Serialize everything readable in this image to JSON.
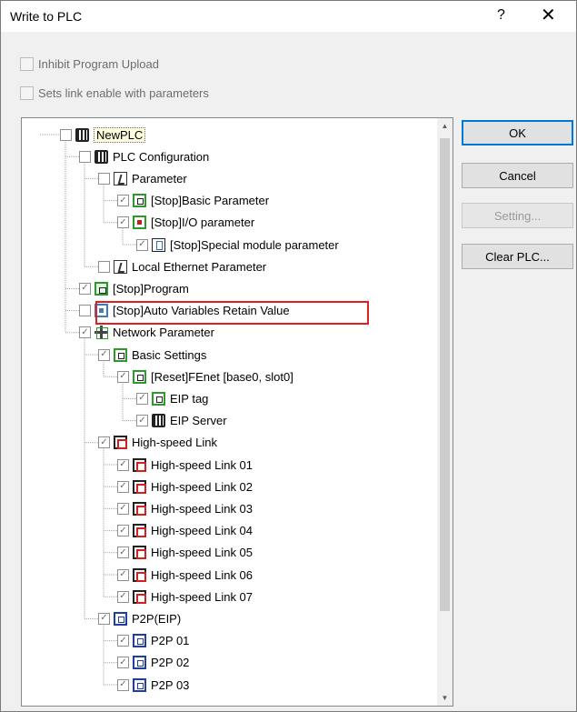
{
  "dialog": {
    "title": "Write to PLC",
    "help_label": "?",
    "close_label": "✕"
  },
  "options": {
    "inhibit_program_upload": {
      "label": "Inhibit Program Upload",
      "checked": false
    },
    "sets_link_enable": {
      "label": "Sets link enable with parameters",
      "checked": false
    }
  },
  "tree": {
    "items": [
      {
        "label": "NewPLC",
        "icon": "plc-icon",
        "checked": false
      },
      {
        "label": "PLC Configuration",
        "icon": "plc-icon",
        "checked": false
      },
      {
        "label": "Parameter",
        "icon": "parameter-icon",
        "checked": false
      },
      {
        "label": "[Stop]Basic Parameter",
        "icon": "basic-parameter-icon",
        "checked": true
      },
      {
        "label": "[Stop]I/O parameter",
        "icon": "io-parameter-icon",
        "checked": true
      },
      {
        "label": "[Stop]Special module parameter",
        "icon": "special-module-icon",
        "checked": true
      },
      {
        "label": "Local Ethernet Parameter",
        "icon": "parameter-icon",
        "checked": false
      },
      {
        "label": "[Stop]Program",
        "icon": "program-icon",
        "checked": true
      },
      {
        "label": "[Stop]Auto Variables Retain Value",
        "icon": "auto-variables-icon",
        "checked": false
      },
      {
        "label": "Network Parameter",
        "icon": "network-icon",
        "checked": true
      },
      {
        "label": "Basic Settings",
        "icon": "basic-parameter-icon",
        "checked": true
      },
      {
        "label": "[Reset]FEnet [base0, slot0]",
        "icon": "basic-parameter-icon",
        "checked": true
      },
      {
        "label": "EIP tag",
        "icon": "basic-parameter-icon",
        "checked": true
      },
      {
        "label": "EIP Server",
        "icon": "plc-icon",
        "checked": true
      },
      {
        "label": "High-speed Link",
        "icon": "high-speed-link-icon",
        "checked": true
      },
      {
        "label": "High-speed Link 01",
        "icon": "high-speed-link-icon",
        "checked": true
      },
      {
        "label": "High-speed Link 02",
        "icon": "high-speed-link-icon",
        "checked": true
      },
      {
        "label": "High-speed Link 03",
        "icon": "high-speed-link-icon",
        "checked": true
      },
      {
        "label": "High-speed Link 04",
        "icon": "high-speed-link-icon",
        "checked": true
      },
      {
        "label": "High-speed Link 05",
        "icon": "high-speed-link-icon",
        "checked": true
      },
      {
        "label": "High-speed Link 06",
        "icon": "high-speed-link-icon",
        "checked": true
      },
      {
        "label": "High-speed Link 07",
        "icon": "high-speed-link-icon",
        "checked": true
      },
      {
        "label": "P2P(EIP)",
        "icon": "p2p-icon",
        "checked": true
      },
      {
        "label": "P2P 01",
        "icon": "p2p-icon",
        "checked": true
      },
      {
        "label": "P2P 02",
        "icon": "p2p-icon",
        "checked": true
      },
      {
        "label": "P2P 03",
        "icon": "p2p-icon",
        "checked": true
      }
    ]
  },
  "buttons": {
    "ok": "OK",
    "cancel": "Cancel",
    "setting": "Setting...",
    "clear_plc": "Clear PLC..."
  },
  "colors": {
    "highlight_border": "#e02020",
    "ok_focus": "#0078d7"
  }
}
